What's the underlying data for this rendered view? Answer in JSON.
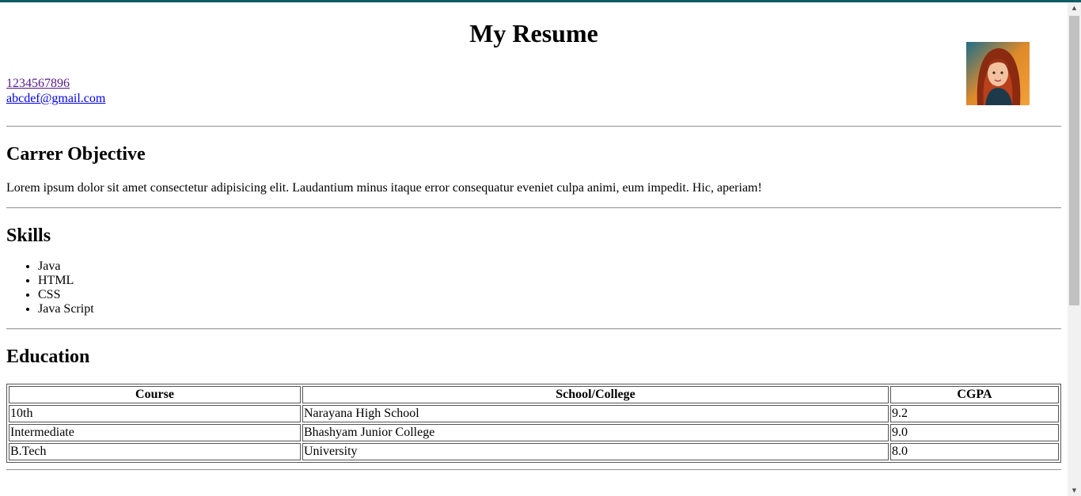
{
  "header": {
    "title": "My Resume"
  },
  "contact": {
    "phone": "1234567896",
    "email": "abcdef@gmail.com"
  },
  "objective": {
    "heading": "Carrer Objective",
    "text": "Lorem ipsum dolor sit amet consectetur adipisicing elit. Laudantium minus itaque error consequatur eveniet culpa animi, eum impedit. Hic, aperiam!"
  },
  "skills": {
    "heading": "Skills",
    "items": [
      "Java",
      "HTML",
      "CSS",
      "Java Script"
    ]
  },
  "education": {
    "heading": "Education",
    "columns": [
      "Course",
      "School/College",
      "CGPA"
    ],
    "rows": [
      [
        "10th",
        "Narayana High School",
        "9.2"
      ],
      [
        "Intermediate",
        "Bhashyam Junior College",
        "9.0"
      ],
      [
        "B.Tech",
        "University",
        "8.0"
      ]
    ]
  },
  "colors": {
    "top_strip": "#0d5c63",
    "visited_link": "#551a8b",
    "link": "#0000ee"
  }
}
